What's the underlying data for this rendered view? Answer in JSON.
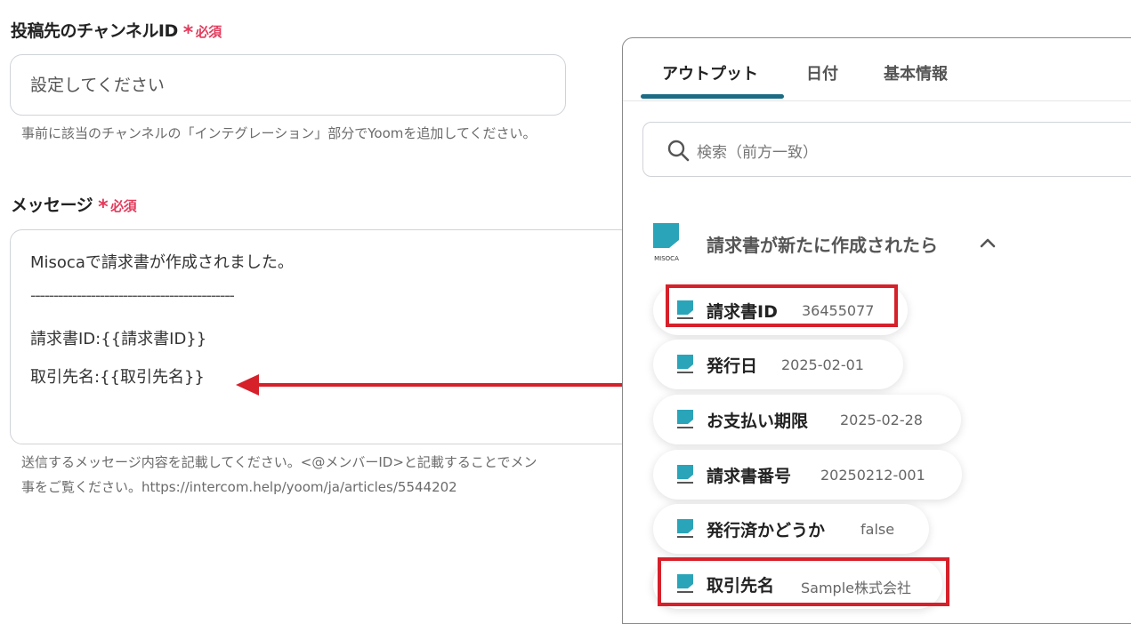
{
  "channel_field": {
    "label": "投稿先のチャンネルID",
    "required_mark": "*",
    "required_text": "必須",
    "placeholder": "設定してください",
    "help": "事前に該当のチャンネルの「インテグレーション」部分でYoomを追加してください。"
  },
  "message_field": {
    "label": "メッセージ",
    "required_mark": "*",
    "required_text": "必須",
    "lines": [
      "Misocaで請求書が作成されました。",
      "--------------------------------------------",
      "請求書ID:{{請求書ID}}",
      "取引先名:{{取引先名}}"
    ],
    "help_line1": "送信するメッセージ内容を記載してください。<@メンバーID>と記載することでメン",
    "help_line2": "事をご覧ください。https://intercom.help/yoom/ja/articles/5544202"
  },
  "panel": {
    "tabs": [
      {
        "label": "アウトプット",
        "active": true
      },
      {
        "label": "日付",
        "active": false
      },
      {
        "label": "基本情報",
        "active": false
      }
    ],
    "search_placeholder": "検索（前方一致）",
    "group": {
      "logo_text": "MISOCA",
      "title": "請求書が新たに作成されたら",
      "chevron": "chevron-up-icon"
    },
    "items": [
      {
        "label": "請求書ID",
        "value": "36455077",
        "highlighted": true
      },
      {
        "label": "発行日",
        "value": "2025-02-01",
        "highlighted": false
      },
      {
        "label": "お支払い期限",
        "value": "2025-02-28",
        "highlighted": false
      },
      {
        "label": "請求書番号",
        "value": "20250212-001",
        "highlighted": false
      },
      {
        "label": "発行済かどうか",
        "value": "false",
        "highlighted": false
      },
      {
        "label": "取引先名",
        "value": "Sample株式会社",
        "highlighted": true
      }
    ]
  },
  "colors": {
    "required": "#e23b5c",
    "highlight": "#d6202a",
    "accent": "#1b6b84",
    "misoca": "#2aa4b8"
  }
}
